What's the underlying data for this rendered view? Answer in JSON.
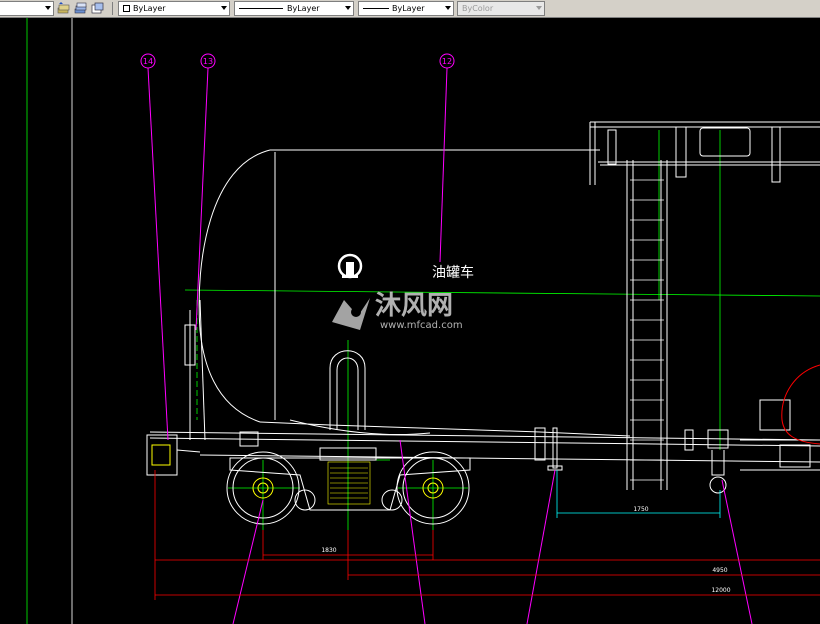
{
  "toolbar": {
    "layer_combo": "",
    "color_combo": "ByLayer",
    "linetype_combo": "ByLayer",
    "lineweight_combo": "ByLayer",
    "plotstyle_combo": "ByColor"
  },
  "icons": [
    "layer-previous-icon",
    "layer-states-icon",
    "layer-manager-icon"
  ],
  "drawing": {
    "balloons": [
      "14",
      "13",
      "12"
    ],
    "car_label": "油罐车",
    "watermark_text": "沐风网",
    "watermark_url": "www.mfcad.com",
    "dimensions": [
      "1750",
      "1830",
      "4950",
      "12000"
    ]
  },
  "colors": {
    "leader": "#ff00ff",
    "dimension": "#ff0000",
    "dim_text": "#00ffff",
    "centerline": "#00ff00",
    "object": "#ffffff",
    "hatch": "#ffff00"
  }
}
